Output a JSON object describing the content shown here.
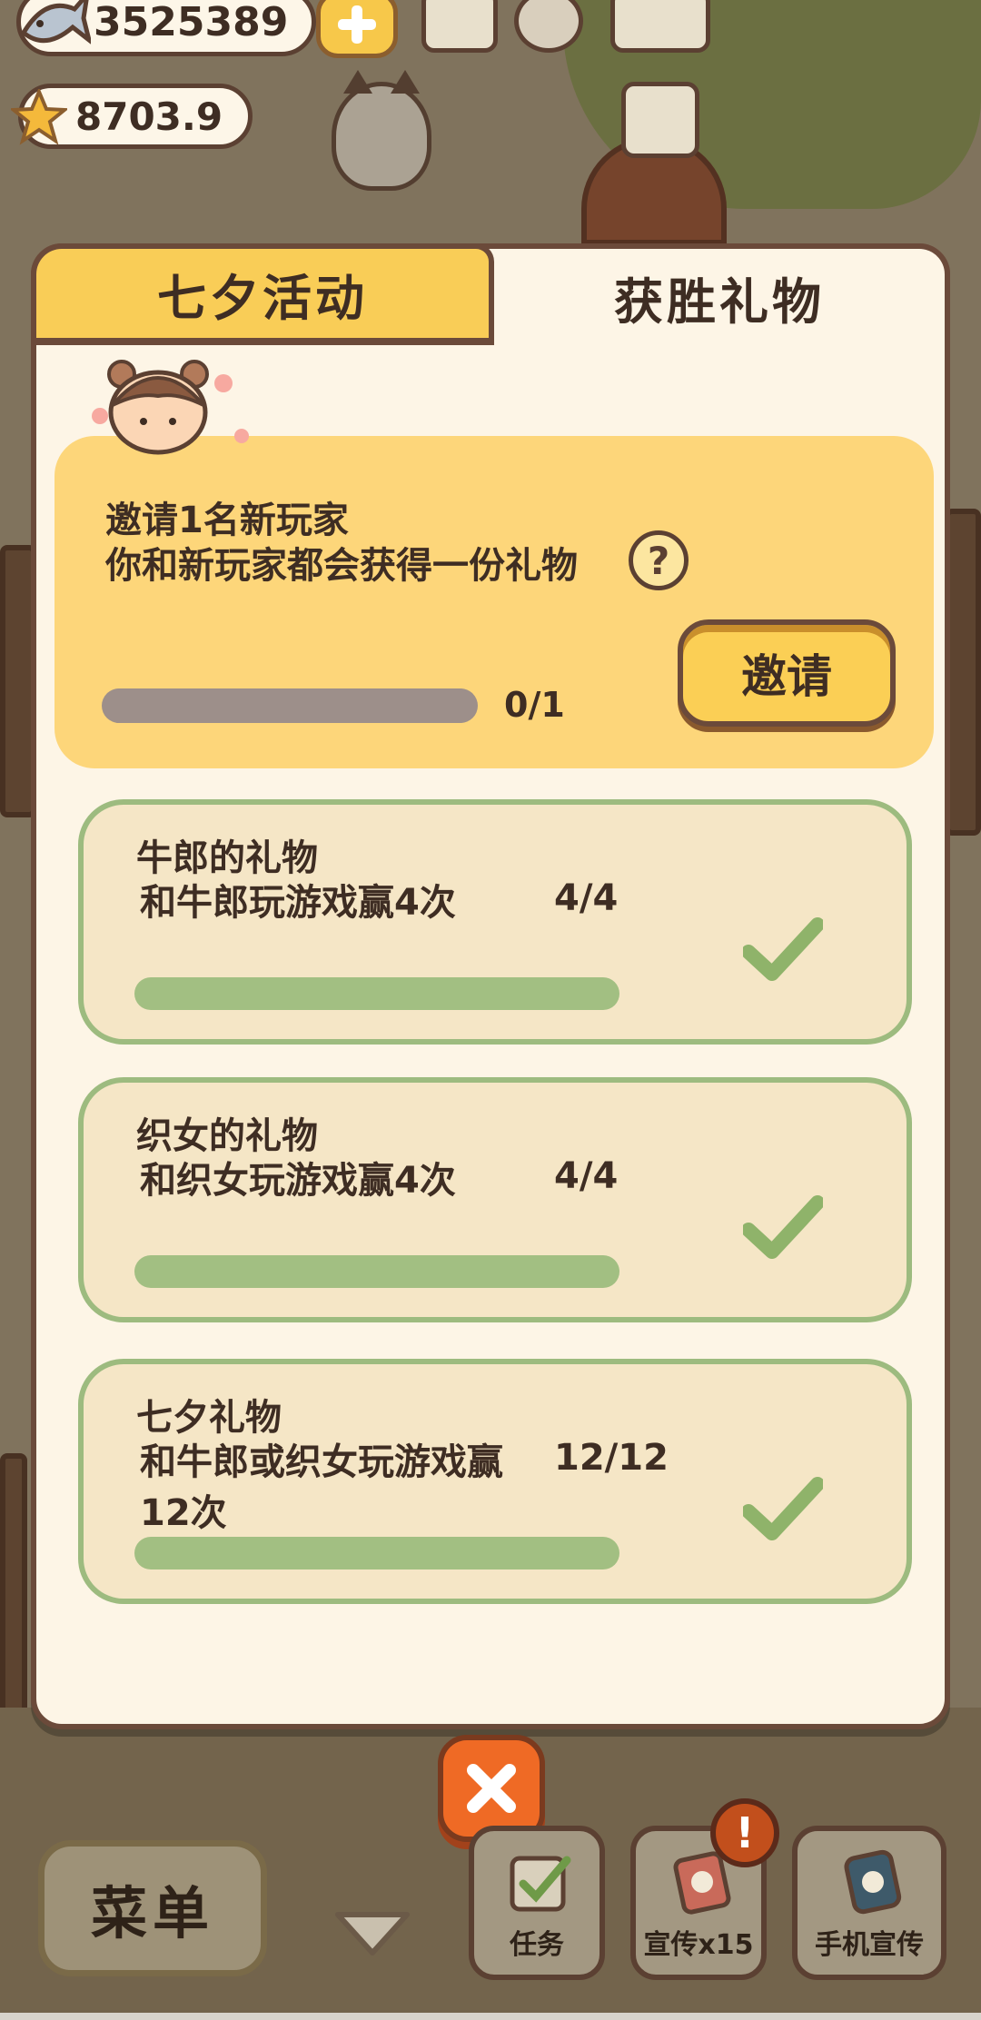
{
  "hud": {
    "fish_count": "3525389",
    "star_count": "8703.9"
  },
  "tabs": [
    {
      "label": "七夕活动",
      "active": false
    },
    {
      "label": "获胜礼物",
      "active": true
    }
  ],
  "invite": {
    "title": "邀请1名新玩家",
    "description": "你和新玩家都会获得一份礼物",
    "progress_text": "0/1",
    "progress": 0,
    "button_label": "邀请"
  },
  "rewards": [
    {
      "title": "牛郎的礼物",
      "description": "和牛郎玩游戏赢4次",
      "count": "4/4",
      "progress": 1,
      "completed": true
    },
    {
      "title": "织女的礼物",
      "description": "和织女玩游戏赢4次",
      "count": "4/4",
      "progress": 1,
      "completed": true
    },
    {
      "title": "七夕礼物",
      "description": "和牛郎或织女玩游戏赢12次",
      "count": "12/12",
      "progress": 1,
      "completed": true
    }
  ],
  "bottom_bar": {
    "menu_label": "菜单",
    "tasks_label": "任务",
    "promo_label": "宣传x15",
    "phone_promo_label": "手机宣传",
    "alert_badge": "!"
  },
  "colors": {
    "accent_yellow": "#f9cd57",
    "complete_green": "#a2bf82",
    "close_orange": "#ef6a25",
    "outline_brown": "#6b4a3a"
  },
  "icons": {
    "fish": "fish-icon",
    "star": "star-icon",
    "help": "question-icon",
    "check": "checkmark-icon",
    "close": "close-icon"
  }
}
